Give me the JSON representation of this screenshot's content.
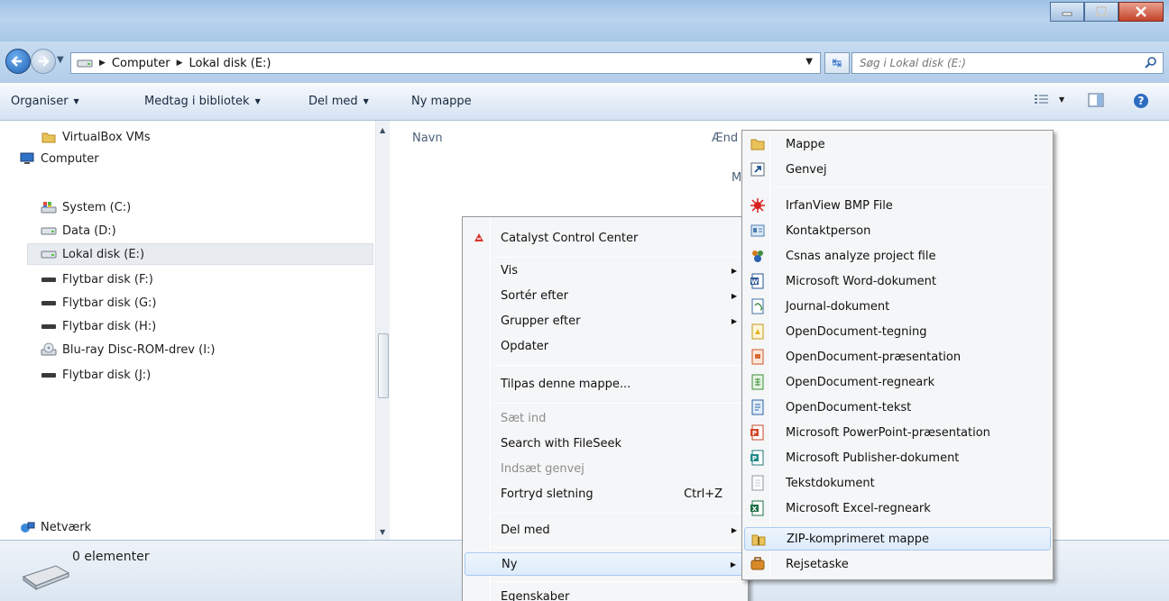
{
  "address": {
    "crumbs": [
      "Computer",
      "Lokal disk (E:)"
    ],
    "search_placeholder": "Søg i Lokal disk (E:)"
  },
  "toolbar": {
    "organize": "Organiser",
    "include_library": "Medtag i bibliotek",
    "share": "Del med",
    "new_folder": "Ny mappe"
  },
  "nav": {
    "items": [
      {
        "label": "VirtualBox VMs",
        "icon": "folder-icon"
      },
      {
        "label": "Computer",
        "icon": "computer-icon"
      },
      {
        "label": "System (C:)",
        "icon": "system-drive-icon"
      },
      {
        "label": "Data (D:)",
        "icon": "drive-icon"
      },
      {
        "label": "Lokal disk (E:)",
        "icon": "drive-icon",
        "selected": true
      },
      {
        "label": "Flytbar disk (F:)",
        "icon": "removable-drive-icon"
      },
      {
        "label": "Flytbar disk (G:)",
        "icon": "removable-drive-icon"
      },
      {
        "label": "Flytbar disk (H:)",
        "icon": "removable-drive-icon"
      },
      {
        "label": "Blu-ray Disc-ROM-drev (I:)",
        "icon": "optical-drive-icon"
      },
      {
        "label": "Flytbar disk (J:)",
        "icon": "removable-drive-icon"
      },
      {
        "label": "Netværk",
        "icon": "network-icon"
      }
    ]
  },
  "content": {
    "col_name": "Navn",
    "col_modified_partial": "Ænd",
    "partial_text": "M"
  },
  "details": {
    "count": "0 elementer"
  },
  "context_menu": {
    "items": [
      {
        "label": "Catalyst Control Center"
      },
      {
        "label": "Vis",
        "submenu": true
      },
      {
        "label": "Sortér efter",
        "submenu": true
      },
      {
        "label": "Grupper efter",
        "submenu": true
      },
      {
        "label": "Opdater"
      },
      {
        "label": "Tilpas denne mappe..."
      },
      {
        "label": "Sæt ind",
        "disabled": true
      },
      {
        "label": "Search with FileSeek"
      },
      {
        "label": "Indsæt genvej",
        "disabled": true
      },
      {
        "label": "Fortryd sletning",
        "shortcut": "Ctrl+Z"
      },
      {
        "label": "Del med",
        "submenu": true
      },
      {
        "label": "Ny",
        "submenu": true,
        "highlighted": true
      },
      {
        "label": "Egenskaber"
      }
    ]
  },
  "new_submenu": {
    "items": [
      {
        "label": "Mappe"
      },
      {
        "label": "Genvej"
      },
      {
        "label": "IrfanView BMP File"
      },
      {
        "label": "Kontaktperson"
      },
      {
        "label": "Csnas analyze project file"
      },
      {
        "label": "Microsoft Word-dokument"
      },
      {
        "label": "Journal-dokument"
      },
      {
        "label": "OpenDocument-tegning"
      },
      {
        "label": "OpenDocument-præsentation"
      },
      {
        "label": "OpenDocument-regneark"
      },
      {
        "label": "OpenDocument-tekst"
      },
      {
        "label": "Microsoft PowerPoint-præsentation"
      },
      {
        "label": "Microsoft Publisher-dokument"
      },
      {
        "label": "Tekstdokument"
      },
      {
        "label": "Microsoft Excel-regneark"
      },
      {
        "label": "ZIP-komprimeret mappe",
        "highlighted": true
      },
      {
        "label": "Rejsetaske"
      }
    ]
  }
}
